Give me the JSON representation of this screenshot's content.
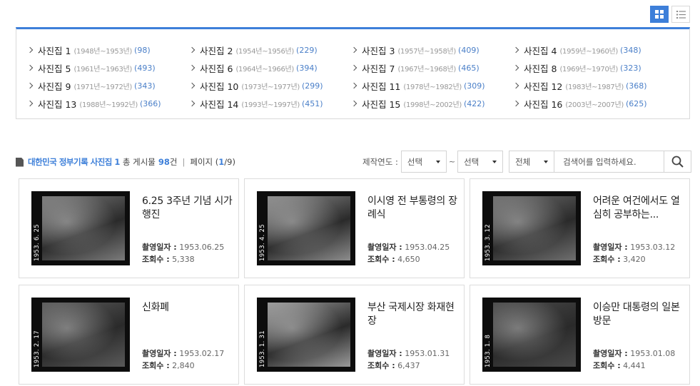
{
  "view_modes": [
    {
      "name": "grid-view-button",
      "icon": "grid-icon",
      "active": true
    },
    {
      "name": "list-view-button",
      "icon": "list-icon",
      "active": false
    }
  ],
  "collections": [
    {
      "name": "사진집 1",
      "range": "(1948년~1953년)",
      "count": "(98)"
    },
    {
      "name": "사진집 2",
      "range": "(1954년~1956년)",
      "count": "(229)"
    },
    {
      "name": "사진집 3",
      "range": "(1957년~1958년)",
      "count": "(409)"
    },
    {
      "name": "사진집 4",
      "range": "(1959년~1960년)",
      "count": "(348)"
    },
    {
      "name": "사진집 5",
      "range": "(1961년~1963년)",
      "count": "(493)"
    },
    {
      "name": "사진집 6",
      "range": "(1964년~1966년)",
      "count": "(394)"
    },
    {
      "name": "사진집 7",
      "range": "(1967년~1968년)",
      "count": "(465)"
    },
    {
      "name": "사진집 8",
      "range": "(1969년~1970년)",
      "count": "(323)"
    },
    {
      "name": "사진집 9",
      "range": "(1971년~1972년)",
      "count": "(343)"
    },
    {
      "name": "사진집 10",
      "range": "(1973년~1977년)",
      "count": "(299)"
    },
    {
      "name": "사진집 11",
      "range": "(1978년~1982년)",
      "count": "(309)"
    },
    {
      "name": "사진집 12",
      "range": "(1983년~1987년)",
      "count": "(368)"
    },
    {
      "name": "사진집 13",
      "range": "(1988년~1992년)",
      "count": "(366)"
    },
    {
      "name": "사진집 14",
      "range": "(1993년~1997년)",
      "count": "(451)"
    },
    {
      "name": "사진집 15",
      "range": "(1998년~2002년)",
      "count": "(422)"
    },
    {
      "name": "사진집 16",
      "range": "(2003년~2007년)",
      "count": "(625)"
    }
  ],
  "info": {
    "title": "대한민국 정부기록 사진집 1",
    "total_prefix": "총 게시물",
    "total_count": "98",
    "total_suffix": "건",
    "separator": "|",
    "page_prefix": "페이지 (",
    "page_current": "1",
    "page_suffix": "/9)"
  },
  "filters": {
    "year_label": "제작연도 :",
    "year_from": "선택",
    "tilde": "~",
    "year_to": "선택",
    "category": "전체",
    "search_placeholder": "검색어를 입력하세요."
  },
  "photos": [
    {
      "title": "6.25 3주년 기념 시가 행진",
      "date_label": "촬영일자 :",
      "date": "1953.06.25",
      "views_label": "조회수 :",
      "views": "5,338",
      "film_date": "1953. 6. 25",
      "tone": "#7a7a7a"
    },
    {
      "title": "이시영 전 부통령의 장례식",
      "date_label": "촬영일자 :",
      "date": "1953.04.25",
      "views_label": "조회수 :",
      "views": "4,650",
      "film_date": "1953. 4. 25",
      "tone": "#8c8c8c"
    },
    {
      "title": "어려운 여건에서도 열심히 공부하는...",
      "date_label": "촬영일자 :",
      "date": "1953.03.12",
      "views_label": "조회수 :",
      "views": "3,420",
      "film_date": "1953. 3. 12",
      "tone": "#6e6e6e"
    },
    {
      "title": "신화폐",
      "date_label": "촬영일자 :",
      "date": "1953.02.17",
      "views_label": "조회수 :",
      "views": "2,840",
      "film_date": "1953. 2. 17",
      "tone": "#5a5a5a"
    },
    {
      "title": "부산 국제시장 화재현장",
      "date_label": "촬영일자 :",
      "date": "1953.01.31",
      "views_label": "조회수 :",
      "views": "6,437",
      "film_date": "1953. 1. 31",
      "tone": "#9a9a9a"
    },
    {
      "title": "이승만 대통령의 일본 방문",
      "date_label": "촬영일자 :",
      "date": "1953.01.08",
      "views_label": "조회수 :",
      "views": "4,441",
      "film_date": "1953. 1. 8",
      "tone": "#4a4a4a"
    }
  ],
  "colors": {
    "accent": "#3d7fd9",
    "count": "#4a7fc8"
  }
}
